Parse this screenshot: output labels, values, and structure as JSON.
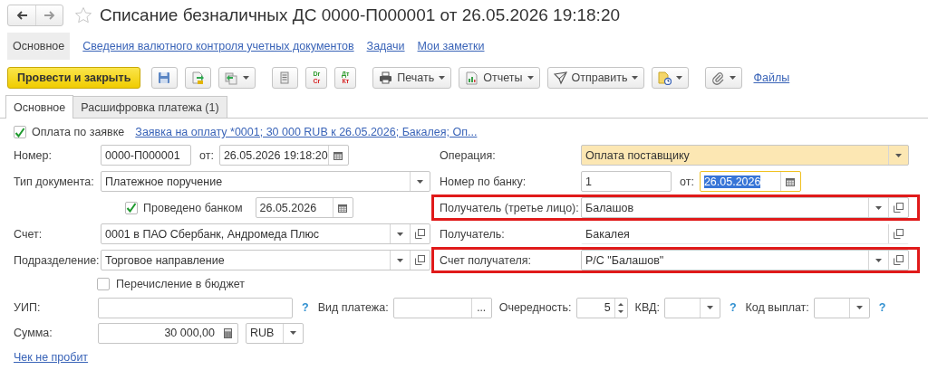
{
  "window": {
    "title": "Списание безналичных ДС 0000-П000001 от 26.05.2026 19:18:20",
    "favorite": false
  },
  "nav_links": [
    {
      "label": "Основное",
      "selected": true
    },
    {
      "label": "Сведения валютного контроля учетных документов",
      "selected": false
    },
    {
      "label": "Задачи",
      "selected": false
    },
    {
      "label": "Мои заметки",
      "selected": false
    }
  ],
  "toolbar": [
    {
      "kind": "primary",
      "label": "Провести и закрыть"
    },
    {
      "kind": "save"
    },
    {
      "kind": "post"
    },
    {
      "kind": "related",
      "menu": true
    },
    {
      "kind": "list"
    },
    {
      "kind": "entries",
      "top": "Dr",
      "bottom": "Cr"
    },
    {
      "kind": "entries",
      "top": "Дт",
      "bottom": "Кт"
    },
    {
      "kind": "print",
      "label": "Печать",
      "menu": true
    },
    {
      "kind": "reports",
      "label": "Отчеты",
      "menu": true
    },
    {
      "kind": "send",
      "label": "Отправить",
      "menu": true
    },
    {
      "kind": "schedule",
      "menu": true
    },
    {
      "kind": "attach",
      "menu": true
    },
    {
      "kind": "link",
      "label": "Файлы"
    }
  ],
  "tabs": [
    {
      "label": "Основное",
      "selected": true
    },
    {
      "label": "Расшифровка платежа (1)",
      "selected": false
    }
  ],
  "order": {
    "checked": true,
    "label": "Оплата по заявке",
    "link": "Заявка на оплату *0001; 30 000 RUB к 26.05.2026; Бакалея; Оп..."
  },
  "left": [
    {
      "kind": "number",
      "label": "Номер:",
      "value": "0000-П000001",
      "date_label": "от:",
      "date": "26.05.2026 19:18:20",
      "focused": false
    },
    {
      "kind": "select",
      "label": "Тип документа:",
      "value": "Платежное поручение",
      "open_button": false,
      "highlighted": false,
      "marked": false
    },
    {
      "kind": "check_date",
      "label": "Проведено банком",
      "checked": true,
      "date": "26.05.2026"
    },
    {
      "kind": "select",
      "label": "Счет:",
      "value": "0001 в ПАО Сбербанк, Андромеда Плюс",
      "open_button": true,
      "highlighted": false,
      "marked": false
    },
    {
      "kind": "select",
      "label": "Подразделение:",
      "value": "Торговое направление",
      "open_button": true,
      "highlighted": false,
      "marked": false
    }
  ],
  "right": [
    {
      "kind": "select",
      "label": "Операция:",
      "value": "Оплата поставщику",
      "open_button": false,
      "highlighted": true,
      "marked": false
    },
    {
      "kind": "number",
      "label": "Номер по банку:",
      "value": "1",
      "date_label": "от:",
      "date": "26.05.2026",
      "focused": true
    },
    {
      "kind": "select",
      "label": "Получатель (третье лицо):",
      "value": "Балашов",
      "open_button": true,
      "highlighted": false,
      "marked": true
    },
    {
      "kind": "readonly",
      "label": "Получатель:",
      "value": "Бакалея"
    },
    {
      "kind": "select",
      "label": "Счет получателя:",
      "value": "Р/С \"Балашов\"",
      "open_button": true,
      "highlighted": false,
      "marked": true
    }
  ],
  "budget": {
    "checked": false,
    "label": "Перечисление в бюджет"
  },
  "payment_row": [
    {
      "kind": "text",
      "label": "УИП:",
      "help": "?"
    },
    {
      "kind": "choice",
      "label": "Вид платежа:",
      "button": "..."
    },
    {
      "kind": "spin",
      "label": "Очередность:",
      "value": "5"
    },
    {
      "kind": "select",
      "label": "КВД:",
      "help": "?"
    },
    {
      "kind": "select",
      "label": "Код выплат:",
      "help": "?"
    }
  ],
  "amount": {
    "label": "Сумма:",
    "value": "30 000,00",
    "currency": "RUB"
  },
  "receipt_link": "Чек не пробит"
}
